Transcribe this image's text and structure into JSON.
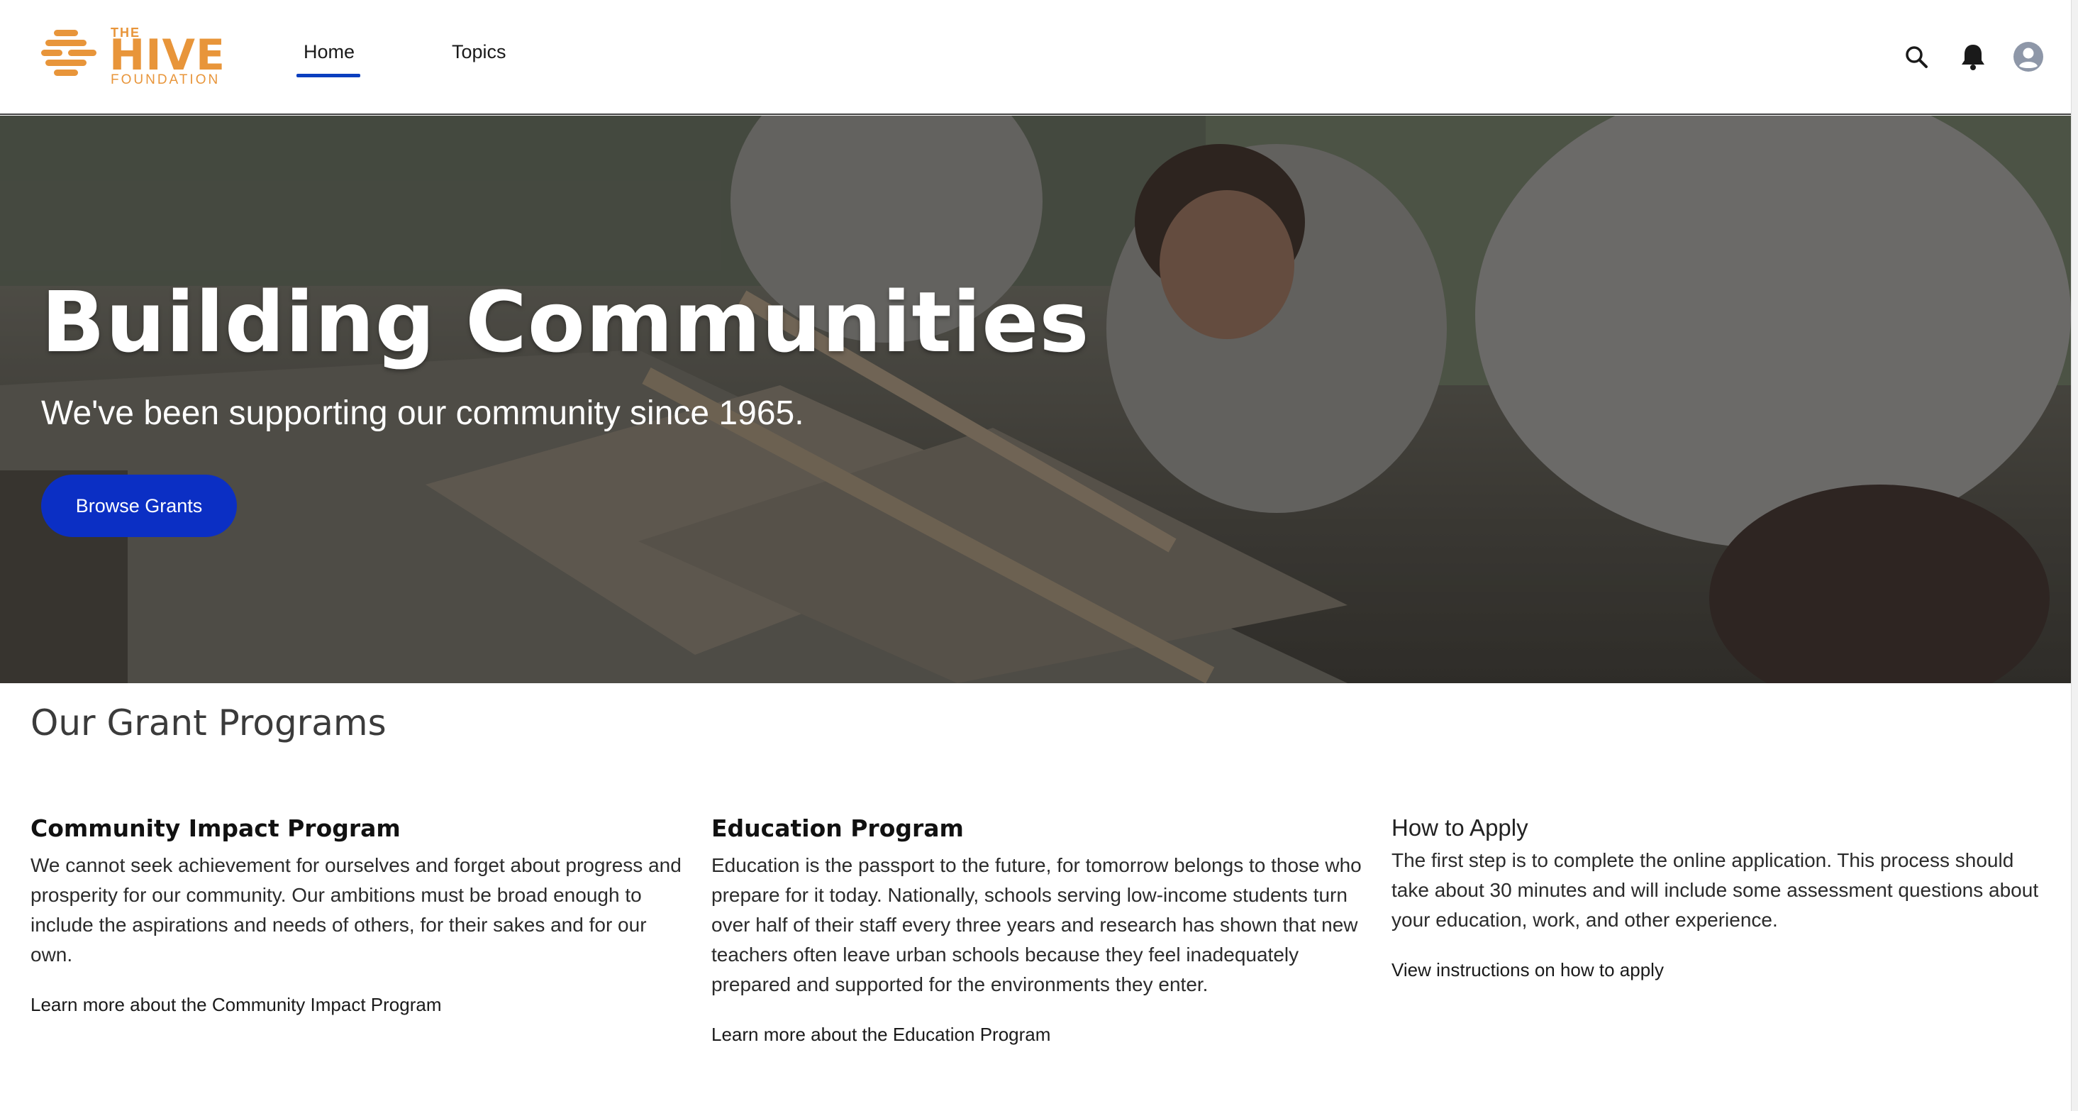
{
  "brand": {
    "logo_the": "THE",
    "logo_hive": "HIVE",
    "logo_foundation": "FOUNDATION",
    "color": "#e8953a"
  },
  "nav": {
    "items": [
      {
        "label": "Home",
        "active": true
      },
      {
        "label": "Topics",
        "active": false
      }
    ],
    "icons": [
      "search-icon",
      "bell-icon",
      "user-avatar-icon"
    ],
    "accent": "#0b3fbf"
  },
  "hero": {
    "title": "Building Communities",
    "subtitle": "We've been supporting our community since 1965.",
    "button_label": "Browse Grants",
    "button_color": "#0b2fc4"
  },
  "programs": {
    "section_title": "Our Grant Programs",
    "items": [
      {
        "title": "Community Impact Program",
        "text": "We cannot seek achievement for ourselves and forget about progress and prosperity for our community. Our ambitions must be broad enough to include the aspirations and needs of others, for their sakes and for our own.",
        "link": "Learn more about the Community Impact Program"
      },
      {
        "title": "Education Program",
        "text": "Education is the passport to the future, for tomorrow belongs to those who prepare for it today. Nationally, schools serving low-income students turn over half of their staff every three years and research has shown that new teachers often leave urban schools because they feel inadequately prepared and supported for the environments they enter.",
        "link": "Learn more about the Education Program"
      },
      {
        "title": "How to Apply",
        "text": "The first step is to complete the online application. This process should take about 30 minutes and will include some assessment questions about your education, work, and other experience.",
        "link": "View instructions on how to apply"
      }
    ]
  }
}
